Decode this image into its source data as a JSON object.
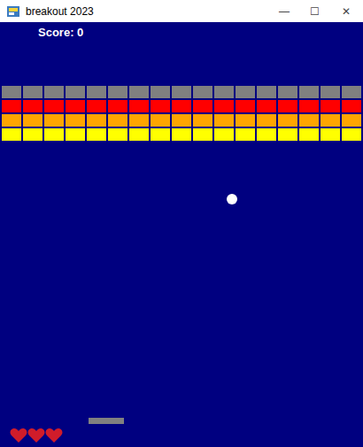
{
  "window": {
    "title": "breakout 2023",
    "controls": [
      "—",
      "☐",
      "✕"
    ]
  },
  "hud": {
    "score": "Score: 0",
    "lives": 3
  },
  "bricks": {
    "rows": [
      {
        "color": "#808080",
        "count": 17
      },
      {
        "color": "#ff0000",
        "count": 17
      },
      {
        "color": "#ffa500",
        "count": 17
      },
      {
        "color": "#ffff00",
        "count": 17
      }
    ]
  }
}
